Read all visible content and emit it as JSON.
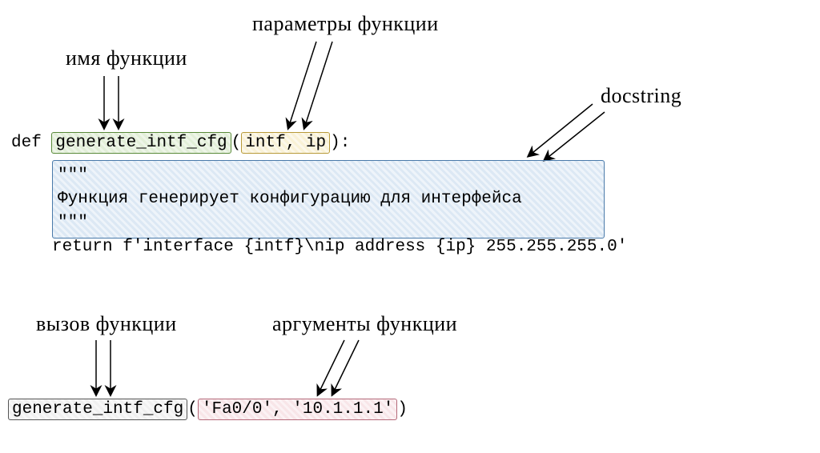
{
  "labels": {
    "func_name": "имя функции",
    "func_params": "параметры функции",
    "docstring": "docstring",
    "func_call": "вызов функции",
    "func_args": "аргументы функции"
  },
  "code": {
    "def_kw": "def ",
    "func_name": "generate_intf_cfg",
    "paren_open": "(",
    "params": "intf, ip",
    "paren_close_colon": "):",
    "doc_q1": "\"\"\"",
    "doc_text": "Функция генерирует конфигурацию для интерфейса",
    "doc_q2": "\"\"\"",
    "return_line": "return f'interface {intf}\\nip address {ip} 255.255.255.0'",
    "call_name": "generate_intf_cfg",
    "call_paren_open": "(",
    "call_args": "'Fa0/0', '10.1.1.1'",
    "call_paren_close": ")"
  },
  "colors": {
    "green": "#5a8a3a",
    "yellow": "#b89a3a",
    "blue": "#4a7aaa",
    "gray": "#555555",
    "pink": "#b56a7a"
  }
}
